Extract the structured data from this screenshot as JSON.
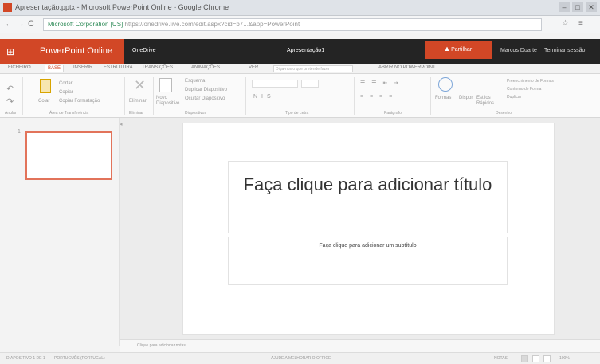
{
  "browser": {
    "window_title": "Apresentação.pptx - Microsoft PowerPoint Online - Google Chrome",
    "url_secure": "Microsoft Corporation [US]",
    "url_text": "https://onedrive.live.com/edit.aspx?cid=b7...&app=PowerPoint",
    "back_glyph": "←",
    "forward_glyph": "→",
    "reload_glyph": "C",
    "star_glyph": "☆",
    "menu_glyph": "≡"
  },
  "office": {
    "app_name": "PowerPoint Online",
    "onedrive_label": "OneDrive",
    "doc_title": "Apresentação1",
    "share_label": "Partilhar",
    "user_name": "Marcos Duarte",
    "sign_out": "Terminar sessão"
  },
  "ribbon": {
    "tabs": [
      "FICHEIRO",
      "BASE",
      "INSERIR",
      "ESTRUTURA",
      "TRANSIÇÕES",
      "ANIMAÇÕES",
      "VER"
    ],
    "active_tab_index": 1,
    "tell_me_placeholder": "Diga-nos o que pretende fazer",
    "open_desktop": "ABRIR NO POWERPOINT",
    "clipboard": {
      "paste": "Colar",
      "cut": "Cortar",
      "copy": "Copiar",
      "format": "Copiar Formatação",
      "group": "Área de Transferência"
    },
    "undo_group": "Anular",
    "delete": {
      "label": "Eliminar",
      "group": "Eliminar"
    },
    "slides": {
      "new": "Novo Diapositivo",
      "layout": "Esquema",
      "duplicate": "Duplicar Diapositivo",
      "hide": "Ocultar Diapositivo",
      "group": "Diapositivos"
    },
    "font_group": "Tipo de Letra",
    "paragraph_group": "Parágrafo",
    "drawing": {
      "shapes": "Formas",
      "arrange": "Dispor",
      "styles": "Estilos Rápidos",
      "group": "Desenho"
    },
    "shape_fill": "Preenchimento de Formas",
    "shape_outline": "Contorno de Forma",
    "duplicate": "Duplicar"
  },
  "slide_panel": {
    "number": "1"
  },
  "slide": {
    "title": "Faça clique para adicionar título",
    "subtitle": "Faça clique para adicionar um subtítulo"
  },
  "notes": {
    "placeholder": "Clique para adicionar notas"
  },
  "status": {
    "slide_count": "DIAPOSITIVO 1 DE 1",
    "language": "PORTUGUÊS (PORTUGAL)",
    "help": "AJUDE A MELHORAR O OFFICE",
    "notes": "NOTAS",
    "zoom": "100%"
  }
}
